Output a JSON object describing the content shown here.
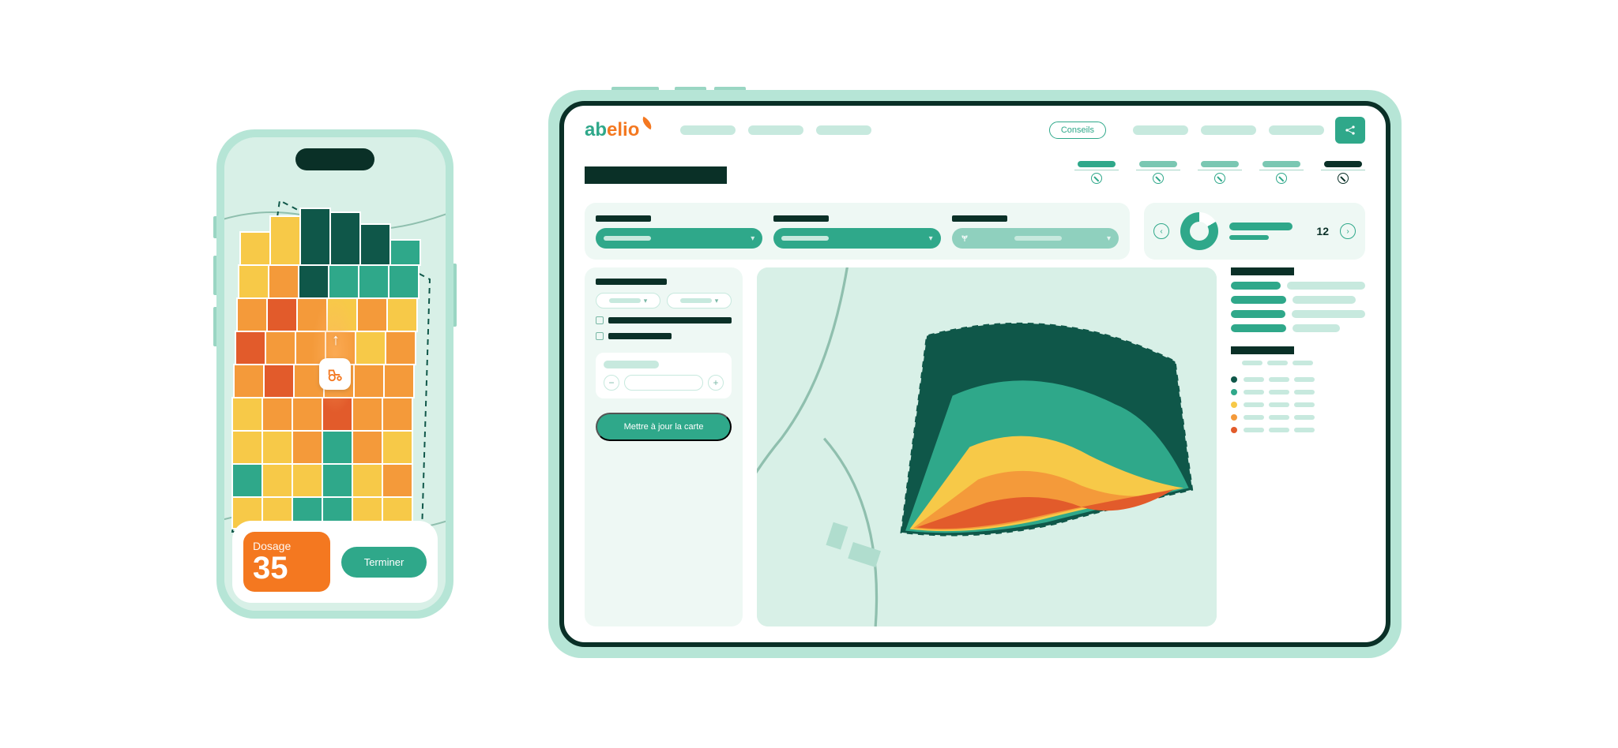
{
  "brand": {
    "name_a": "ab",
    "name_b": "elio"
  },
  "phone": {
    "dosage_label": "Dosage",
    "dosage_value": "35",
    "finish_label": "Terminer",
    "arrow_glyph": "↑"
  },
  "tablet": {
    "header": {
      "conseils_label": "Conseils"
    },
    "donut": {
      "value": "12"
    },
    "side": {
      "update_label": "Mettre à jour la carte"
    },
    "legend_colors": [
      "#0f5749",
      "#2fa88a",
      "#f7c948",
      "#f49a3a",
      "#e25b2b"
    ]
  },
  "colors": {
    "brand_green": "#2fa88a",
    "brand_orange": "#f47820",
    "dark": "#0a3027",
    "mint_bg": "#d8f0e7",
    "mint_light": "#eef8f4"
  }
}
